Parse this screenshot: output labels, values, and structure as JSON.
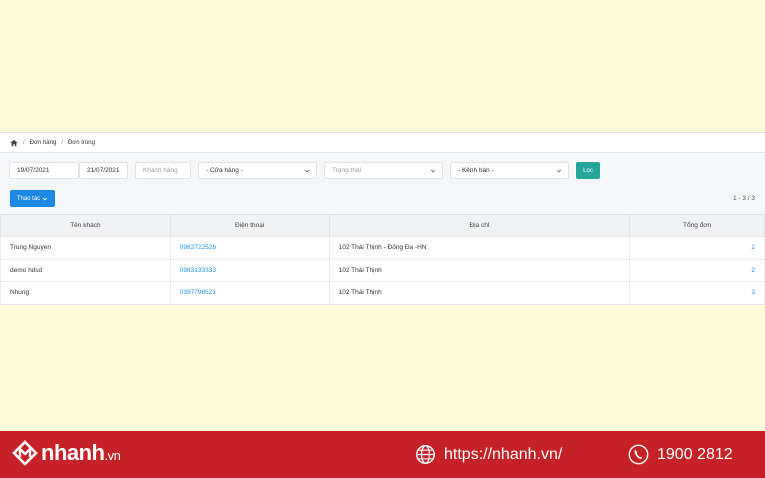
{
  "breadcrumb": {
    "items": [
      "Đơn hàng",
      "Đơn trùng"
    ]
  },
  "filters": {
    "date_from": "19/07/2021",
    "date_to": "21/07/2021",
    "customer_placeholder": "Khách hàng",
    "store": "- Cửa hàng -",
    "status_placeholder": "Trạng thái",
    "channel": "- Kênh bán -",
    "filter_button": "Lọc"
  },
  "actions": {
    "label": "Thao tác"
  },
  "pager": "1 - 3 / 3",
  "table": {
    "headers": [
      "Tên khách",
      "Điện thoại",
      "Địa chỉ",
      "Tổng đơn"
    ],
    "rows": [
      {
        "name": "Trung Nguyen",
        "phone": "0982722526",
        "address": "102 Thái Thịnh - Đống Đa -HN",
        "orders": "2"
      },
      {
        "name": "demo hdsd",
        "phone": "0983133333",
        "address": "102 Thái Thịnh",
        "orders": "2"
      },
      {
        "name": "Nhung",
        "phone": "0397798521",
        "address": "102 Thái Thịnh",
        "orders": "3"
      }
    ]
  },
  "footer": {
    "brand": "nhanh",
    "brand_tld": ".vn",
    "website": "https://nhanh.vn/",
    "hotline": "1900 2812",
    "brand_color": "#c62127"
  }
}
